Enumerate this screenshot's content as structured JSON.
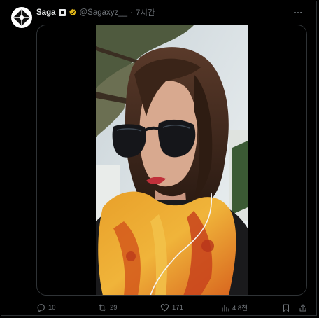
{
  "tweet": {
    "author_name": "Saga",
    "handle": "@Sagaxyz__",
    "separator": "·",
    "time": "7시간",
    "verified": true
  },
  "media": {
    "type": "photo"
  },
  "actions": {
    "reply_count": "10",
    "repost_count": "29",
    "like_count": "171",
    "views_count": "4.8천"
  },
  "icons": {
    "avatar": "saga-logo-icon",
    "flag": "flag-badge-icon",
    "verified": "verified-badge-icon",
    "more": "more-icon",
    "reply": "reply-icon",
    "repost": "repost-icon",
    "like": "heart-icon",
    "views": "views-icon",
    "bookmark": "bookmark-icon",
    "share": "share-icon"
  },
  "colors": {
    "background": "#000000",
    "text_primary": "#e7e9ea",
    "text_secondary": "#71767b",
    "border": "#2f3336",
    "verified_gold": "#e2b719"
  }
}
